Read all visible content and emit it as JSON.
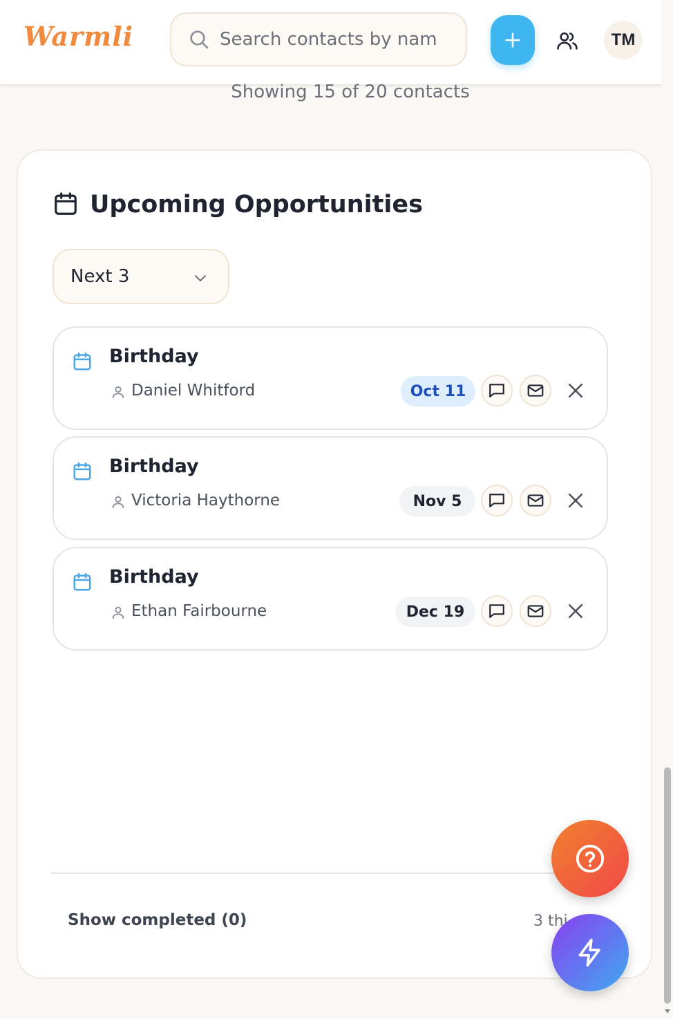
{
  "app": {
    "logo": "Warmli"
  },
  "search": {
    "placeholder": "Search contacts by nam"
  },
  "header": {
    "avatar_initials": "TM"
  },
  "summary": {
    "showing": "Showing 15 of 20 contacts"
  },
  "opportunities": {
    "title": "Upcoming Opportunities",
    "filter": {
      "selected": "Next 3"
    },
    "items": [
      {
        "title": "Birthday",
        "name": "Daniel Whitford",
        "date": "Oct 11",
        "date_style": "highlight"
      },
      {
        "title": "Birthday",
        "name": "Victoria Haythorne",
        "date": "Nov 5",
        "date_style": "neutral"
      },
      {
        "title": "Birthday",
        "name": "Ethan Fairbourne",
        "date": "Dec 19",
        "date_style": "neutral"
      }
    ],
    "show_completed": "Show completed (0)",
    "footer_count": "3 thi"
  },
  "colors": {
    "brand": "#f08a3e",
    "accent_blue": "#3fb6ef",
    "date_highlight_bg": "#dfeefd",
    "date_highlight_text": "#1e4fb8",
    "date_neutral_bg": "#f2f3f5"
  },
  "icons": [
    "search-icon",
    "plus-icon",
    "contacts-icon",
    "calendar-icon",
    "chevron-down-icon",
    "person-icon",
    "message-icon",
    "mail-icon",
    "close-icon",
    "help-icon",
    "lightning-icon"
  ]
}
